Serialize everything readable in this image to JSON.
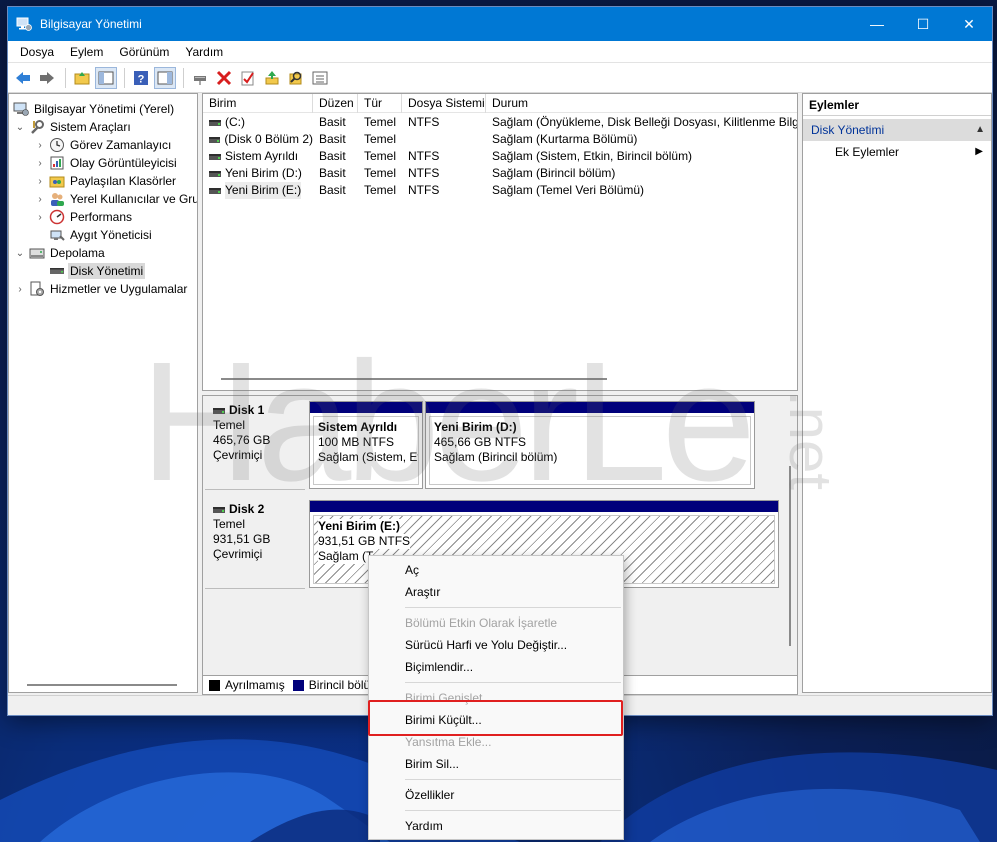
{
  "window": {
    "title": "Bilgisayar Yönetimi",
    "controls": {
      "minimize": "—",
      "maximize": "☐",
      "close": "✕"
    }
  },
  "menubar": [
    "Dosya",
    "Eylem",
    "Görünüm",
    "Yardım"
  ],
  "toolbar": {
    "icons": [
      "back-icon",
      "forward-icon",
      "up-folder-icon",
      "show-hide-tree-icon",
      "help-icon",
      "properties-view-icon",
      "connect-drive-icon",
      "delete-icon",
      "check-icon",
      "import-icon",
      "search-icon",
      "list-icon"
    ]
  },
  "tree": {
    "nodes": [
      {
        "label": "Bilgisayar Yönetimi (Yerel)",
        "icon": "computer-icon",
        "chevron": ""
      },
      {
        "label": "Sistem Araçları",
        "icon": "tools-icon",
        "chevron": "⌄"
      },
      {
        "label": "Görev Zamanlayıcı",
        "icon": "clock-icon",
        "chevron": "›"
      },
      {
        "label": "Olay Görüntüleyicisi",
        "icon": "event-viewer-icon",
        "chevron": "›"
      },
      {
        "label": "Paylaşılan Klasörler",
        "icon": "shared-folder-icon",
        "chevron": "›"
      },
      {
        "label": "Yerel Kullanıcılar ve Gru",
        "icon": "users-icon",
        "chevron": "›"
      },
      {
        "label": "Performans",
        "icon": "performance-icon",
        "chevron": "›"
      },
      {
        "label": "Aygıt Yöneticisi",
        "icon": "device-manager-icon",
        "chevron": ""
      },
      {
        "label": "Depolama",
        "icon": "storage-icon",
        "chevron": "⌄"
      },
      {
        "label": "Disk Yönetimi",
        "icon": "disk-management-icon",
        "chevron": ""
      },
      {
        "label": "Hizmetler ve Uygulamalar",
        "icon": "services-icon",
        "chevron": "›"
      }
    ]
  },
  "volumes": {
    "columns": [
      "Birim",
      "Düzen",
      "Tür",
      "Dosya Sistemi",
      "Durum"
    ],
    "rows": [
      [
        "(C:)",
        "Basit",
        "Temel",
        "NTFS",
        "Sağlam (Önyükleme, Disk Belleği Dosyası, Kilitlenme Bilgisi"
      ],
      [
        "(Disk 0 Bölüm 2)",
        "Basit",
        "Temel",
        "",
        "Sağlam (Kurtarma Bölümü)"
      ],
      [
        "Sistem Ayrıldı",
        "Basit",
        "Temel",
        "NTFS",
        "Sağlam (Sistem, Etkin, Birincil bölüm)"
      ],
      [
        "Yeni Birim (D:)",
        "Basit",
        "Temel",
        "NTFS",
        "Sağlam (Birincil bölüm)"
      ],
      [
        "Yeni Birim (E:)",
        "Basit",
        "Temel",
        "NTFS",
        "Sağlam (Temel Veri Bölümü)"
      ]
    ]
  },
  "disks": [
    {
      "name": "Disk 1",
      "type": "Temel",
      "size": "465,76 GB",
      "status": "Çevrimiçi",
      "partitions": [
        {
          "name": "Sistem Ayrıldı",
          "size": "100 MB NTFS",
          "status": "Sağlam (Sistem, Etk"
        },
        {
          "name": "Yeni Birim  (D:)",
          "size": "465,66 GB NTFS",
          "status": "Sağlam (Birincil bölüm)"
        }
      ]
    },
    {
      "name": "Disk 2",
      "type": "Temel",
      "size": "931,51 GB",
      "status": "Çevrimiçi",
      "partitions": [
        {
          "name": "Yeni Birim  (E:)",
          "size": "931,51 GB NTFS",
          "status": "Sağlam (T"
        }
      ]
    }
  ],
  "legend": [
    {
      "label": "Ayrılmamış",
      "color": "#000000"
    },
    {
      "label": "Birincil bölü",
      "color": "#00007b"
    }
  ],
  "actions": {
    "header": "Eylemler",
    "section": "Disk Yönetimi",
    "item": "Ek Eylemler"
  },
  "context_menu": {
    "items": [
      {
        "label": "Aç",
        "enabled": true
      },
      {
        "label": "Araştır",
        "enabled": true
      },
      {
        "label": "Bölümü Etkin Olarak İşaretle",
        "enabled": false
      },
      {
        "label": "Sürücü Harfi ve Yolu Değiştir...",
        "enabled": true
      },
      {
        "label": "Biçimlendir...",
        "enabled": true
      },
      {
        "label": "Birimi Genişlet...",
        "enabled": false
      },
      {
        "label": "Birimi Küçült...",
        "enabled": true,
        "highlighted": true
      },
      {
        "label": "Yansıtma Ekle...",
        "enabled": false
      },
      {
        "label": "Birim Sil...",
        "enabled": true
      },
      {
        "label": "Özellikler",
        "enabled": true
      },
      {
        "label": "Yardım",
        "enabled": true
      }
    ],
    "highlight_color": "#e02020"
  },
  "watermark": "HaberLe.net",
  "colors": {
    "titlebar": "#0078d4",
    "primary_partition": "#00007b",
    "selection": "#d9d9d9"
  }
}
